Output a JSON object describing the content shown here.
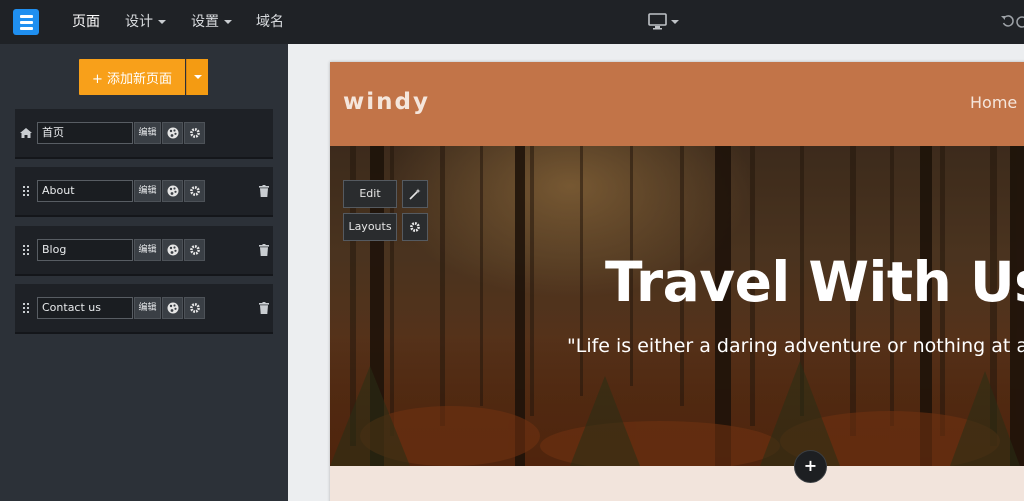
{
  "topbar": {
    "nav": [
      "页面",
      "设计",
      "设置",
      "域名"
    ]
  },
  "sidebar": {
    "add_page_label": "+ 添加新页面",
    "edit_label": "编辑",
    "pages": [
      {
        "name": "首页",
        "icon": "home-icon"
      },
      {
        "name": "About",
        "icon": "drag-handle-icon"
      },
      {
        "name": "Blog",
        "icon": "drag-handle-icon"
      },
      {
        "name": "Contact us",
        "icon": "drag-handle-icon"
      }
    ]
  },
  "site": {
    "brand": "windy",
    "menu_home": "Home",
    "hero_title": "Travel With Us",
    "hero_subtitle": "\"Life is either a daring adventure or nothing at a",
    "tools": {
      "edit": "Edit",
      "layouts": "Layouts"
    },
    "add_section": "+"
  },
  "colors": {
    "accent": "#f8a01a",
    "header_bg": "#c27448",
    "topbar_bg": "#1f2226",
    "sidebar_bg": "#2c3138"
  }
}
